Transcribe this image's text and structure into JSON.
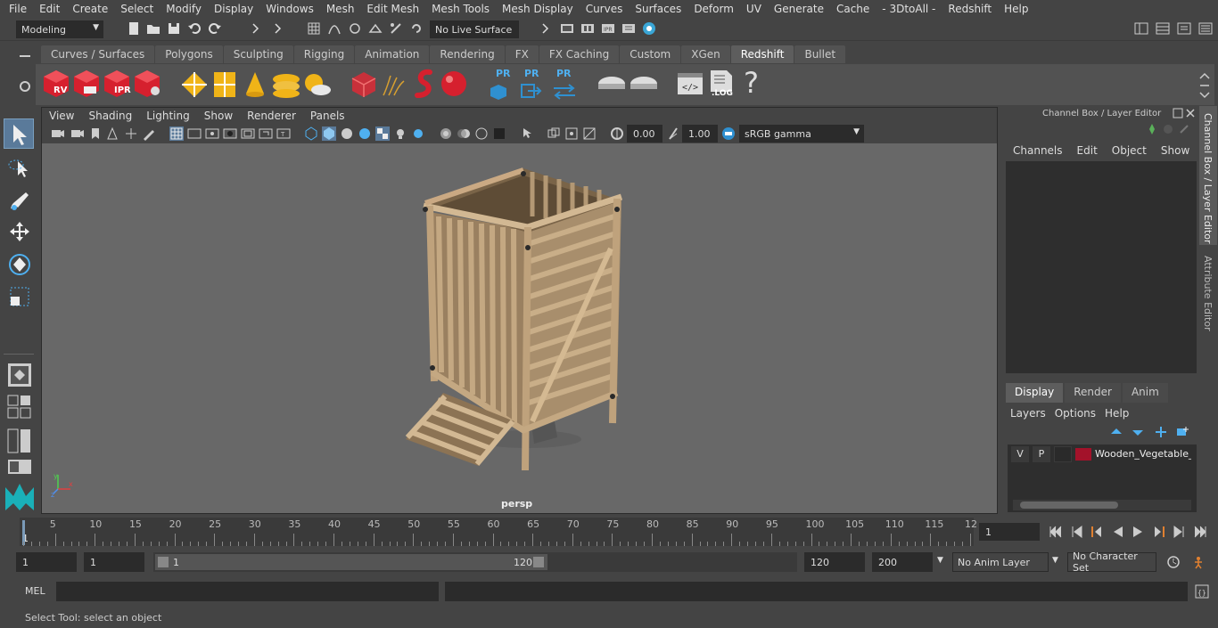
{
  "menubar": [
    "File",
    "Edit",
    "Create",
    "Select",
    "Modify",
    "Display",
    "Windows",
    "Mesh",
    "Edit Mesh",
    "Mesh Tools",
    "Mesh Display",
    "Curves",
    "Surfaces",
    "Deform",
    "UV",
    "Generate",
    "Cache",
    "- 3DtoAll -",
    "Redshift",
    "Help"
  ],
  "status": {
    "workspace": "Modeling",
    "live_surface": "No Live Surface"
  },
  "shelf": {
    "tabs": [
      "Curves / Surfaces",
      "Polygons",
      "Sculpting",
      "Rigging",
      "Animation",
      "Rendering",
      "FX",
      "FX Caching",
      "Custom",
      "XGen",
      "Redshift",
      "Bullet"
    ],
    "active_tab": "Redshift",
    "labels": {
      "rv": "RV",
      "ipr": "IPR",
      "pr": "PR",
      "log": ".LOG",
      "help": "?"
    }
  },
  "viewport": {
    "menus": [
      "View",
      "Shading",
      "Lighting",
      "Show",
      "Renderer",
      "Panels"
    ],
    "exposure": "0.00",
    "gamma": "1.00",
    "color_space": "sRGB gamma",
    "camera_label": "persp"
  },
  "channel_box": {
    "title": "Channel Box / Layer Editor",
    "menus": [
      "Channels",
      "Edit",
      "Object",
      "Show"
    ]
  },
  "layer_editor": {
    "tabs": [
      "Display",
      "Render",
      "Anim"
    ],
    "active_tab": "Display",
    "menus": [
      "Layers",
      "Options",
      "Help"
    ],
    "layer": {
      "v": "V",
      "p": "P",
      "name": "Wooden_Vegetable_R",
      "color": "#a3122a"
    }
  },
  "side_tabs": [
    "Channel Box / Layer Editor",
    "Attribute Editor"
  ],
  "timeline": {
    "ticks": [
      "5",
      "10",
      "15",
      "20",
      "25",
      "30",
      "35",
      "40",
      "45",
      "50",
      "55",
      "60",
      "65",
      "70",
      "75",
      "80",
      "85",
      "90",
      "95",
      "100",
      "105",
      "110",
      "115",
      "12"
    ],
    "start_label": "1",
    "current_frame": "1"
  },
  "range": {
    "start": "1",
    "playback_start": "1",
    "slider_start": "1",
    "slider_end": "120",
    "playback_end": "120",
    "end": "200",
    "anim_layer": "No Anim Layer",
    "character_set": "No Character Set"
  },
  "command": {
    "label": "MEL"
  },
  "help": "Select Tool: select an object"
}
